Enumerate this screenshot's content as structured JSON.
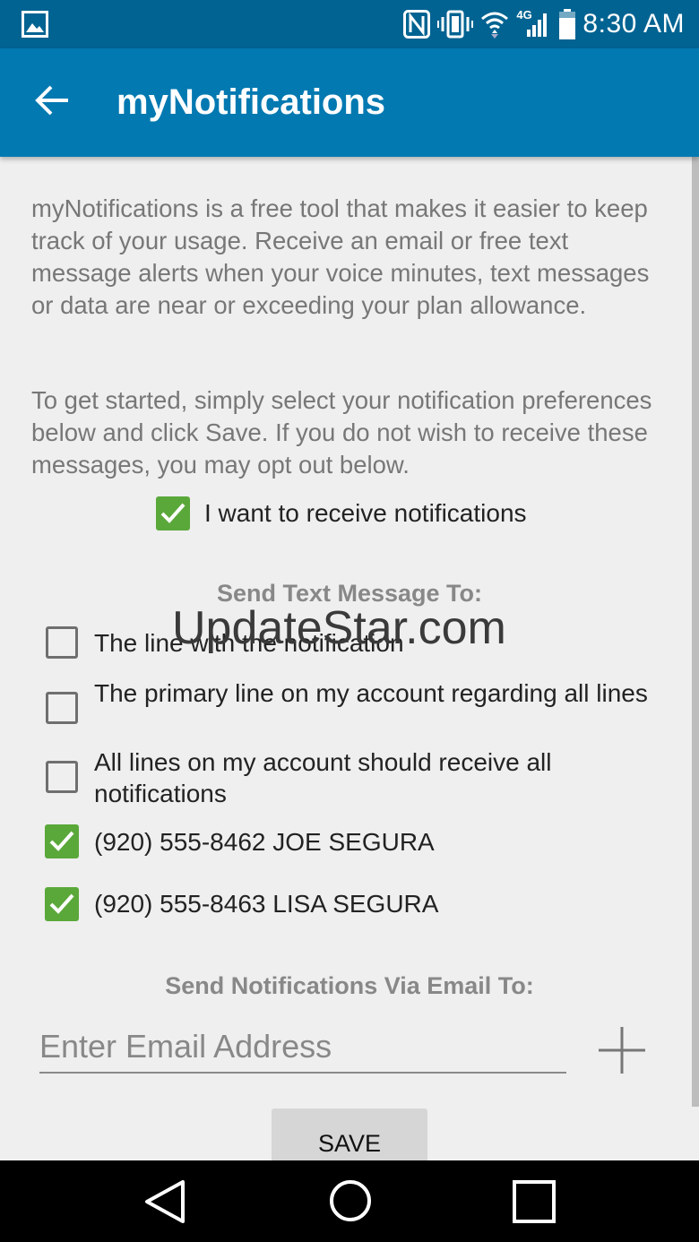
{
  "status_bar": {
    "time": "8:30 AM",
    "network_label": "4G",
    "icons": [
      "gallery-icon",
      "nfc-icon",
      "vibrate-icon",
      "wifi-icon",
      "signal-icon",
      "battery-icon"
    ]
  },
  "app_bar": {
    "title": "myNotifications",
    "back_icon": "arrow-back-icon"
  },
  "intro": {
    "paragraph1": "myNotifications is a free tool that makes it easier to keep track of your usage. Receive an email or free text message alerts when your voice minutes, text messages or data are near or exceeding your plan allowance.",
    "paragraph2": "To get started, simply select your notification preferences below and click Save. If you do not wish to receive these messages, you may opt out below."
  },
  "opt_in": {
    "label": "I want to receive notifications",
    "checked": true
  },
  "text_section": {
    "heading": "Send Text Message To:",
    "options": [
      {
        "label": "The line with the notification",
        "checked": false
      },
      {
        "label": "The primary line on my account regarding all lines",
        "checked": false
      },
      {
        "label": "All lines on my account should receive all notifications",
        "checked": false
      },
      {
        "label": "(920) 555-8462 JOE SEGURA",
        "checked": true
      },
      {
        "label": "(920) 555-8463 LISA SEGURA",
        "checked": true
      }
    ]
  },
  "watermark": "UpdateStar.com",
  "email_section": {
    "heading": "Send Notifications Via Email To:",
    "placeholder": "Enter Email Address",
    "value": "",
    "add_icon": "plus-icon"
  },
  "save_label": "SAVE",
  "colors": {
    "status_bar": "#016392",
    "app_bar": "#0379b1",
    "check_green": "#5aa83a",
    "background": "#efefef"
  }
}
